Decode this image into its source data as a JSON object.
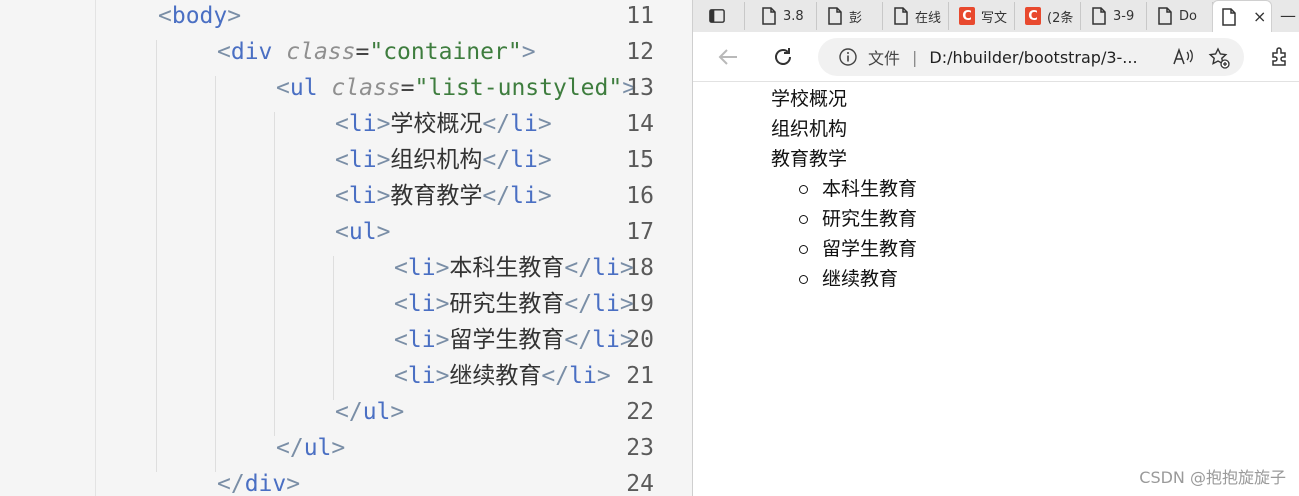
{
  "editor": {
    "lines": [
      {
        "num": "11",
        "indent": 0,
        "parts": [
          [
            "br",
            "<"
          ],
          [
            "tg",
            "body"
          ],
          [
            "br",
            ">"
          ]
        ]
      },
      {
        "num": "12",
        "indent": 1,
        "parts": [
          [
            "br",
            "<"
          ],
          [
            "tg",
            "div "
          ],
          [
            "at",
            "class"
          ],
          [
            "eq",
            "="
          ],
          [
            "st",
            "\"container\""
          ],
          [
            "br",
            ">"
          ]
        ]
      },
      {
        "num": "13",
        "indent": 2,
        "parts": [
          [
            "br",
            "<"
          ],
          [
            "tg",
            "ul "
          ],
          [
            "at",
            "class"
          ],
          [
            "eq",
            "="
          ],
          [
            "st",
            "\"list-unstyled\""
          ],
          [
            "br",
            ">"
          ]
        ]
      },
      {
        "num": "14",
        "indent": 3,
        "parts": [
          [
            "br",
            "<"
          ],
          [
            "tg",
            "li"
          ],
          [
            "br",
            ">"
          ],
          [
            "tx",
            "学校概况"
          ],
          [
            "br",
            "</"
          ],
          [
            "tg",
            "li"
          ],
          [
            "br",
            ">"
          ]
        ]
      },
      {
        "num": "15",
        "indent": 3,
        "parts": [
          [
            "br",
            "<"
          ],
          [
            "tg",
            "li"
          ],
          [
            "br",
            ">"
          ],
          [
            "tx",
            "组织机构"
          ],
          [
            "br",
            "</"
          ],
          [
            "tg",
            "li"
          ],
          [
            "br",
            ">"
          ]
        ]
      },
      {
        "num": "16",
        "indent": 3,
        "parts": [
          [
            "br",
            "<"
          ],
          [
            "tg",
            "li"
          ],
          [
            "br",
            ">"
          ],
          [
            "tx",
            "教育教学"
          ],
          [
            "br",
            "</"
          ],
          [
            "tg",
            "li"
          ],
          [
            "br",
            ">"
          ]
        ]
      },
      {
        "num": "17",
        "indent": 3,
        "parts": [
          [
            "br",
            "<"
          ],
          [
            "tg",
            "ul"
          ],
          [
            "br",
            ">"
          ]
        ]
      },
      {
        "num": "18",
        "indent": 4,
        "parts": [
          [
            "br",
            "<"
          ],
          [
            "tg",
            "li"
          ],
          [
            "br",
            ">"
          ],
          [
            "tx",
            "本科生教育"
          ],
          [
            "br",
            "</"
          ],
          [
            "tg",
            "li"
          ],
          [
            "br",
            ">"
          ]
        ]
      },
      {
        "num": "19",
        "indent": 4,
        "parts": [
          [
            "br",
            "<"
          ],
          [
            "tg",
            "li"
          ],
          [
            "br",
            ">"
          ],
          [
            "tx",
            "研究生教育"
          ],
          [
            "br",
            "</"
          ],
          [
            "tg",
            "li"
          ],
          [
            "br",
            ">"
          ]
        ]
      },
      {
        "num": "20",
        "indent": 4,
        "parts": [
          [
            "br",
            "<"
          ],
          [
            "tg",
            "li"
          ],
          [
            "br",
            ">"
          ],
          [
            "tx",
            "留学生教育"
          ],
          [
            "br",
            "</"
          ],
          [
            "tg",
            "li"
          ],
          [
            "br",
            ">"
          ]
        ]
      },
      {
        "num": "21",
        "indent": 4,
        "parts": [
          [
            "br",
            "<"
          ],
          [
            "tg",
            "li"
          ],
          [
            "br",
            ">"
          ],
          [
            "tx",
            "继续教育"
          ],
          [
            "br",
            "</"
          ],
          [
            "tg",
            "li"
          ],
          [
            "br",
            ">"
          ]
        ]
      },
      {
        "num": "22",
        "indent": 3,
        "parts": [
          [
            "br",
            "</"
          ],
          [
            "tg",
            "ul"
          ],
          [
            "br",
            ">"
          ]
        ]
      },
      {
        "num": "23",
        "indent": 2,
        "parts": [
          [
            "br",
            "</"
          ],
          [
            "tg",
            "ul"
          ],
          [
            "br",
            ">"
          ]
        ]
      },
      {
        "num": "24",
        "indent": 1,
        "parts": [
          [
            "br",
            "</"
          ],
          [
            "tg",
            "div"
          ],
          [
            "br",
            ">"
          ]
        ]
      }
    ]
  },
  "browser": {
    "tabs": [
      {
        "title": "3.8",
        "icon": "page-icon"
      },
      {
        "title": "彭",
        "icon": "page-icon"
      },
      {
        "title": "在线",
        "icon": "page-icon"
      },
      {
        "title": "写文",
        "icon": "csdn-icon",
        "badge": "C"
      },
      {
        "title": "(2条",
        "icon": "csdn-icon",
        "badge": "C"
      },
      {
        "title": "3-9",
        "icon": "page-icon"
      },
      {
        "title": "Do",
        "icon": "page-icon"
      }
    ],
    "active_tab_close": "×",
    "minimize": "—",
    "address": {
      "scheme": "文件",
      "separator": "|",
      "url": "D:/hbuilder/bootstrap/3-..."
    },
    "page": {
      "top_items": [
        "学校概况",
        "组织机构",
        "教育教学"
      ],
      "sub_items": [
        "本科生教育",
        "研究生教育",
        "留学生教育",
        "继续教育"
      ]
    },
    "watermark": "CSDN @抱抱旋旋子"
  }
}
